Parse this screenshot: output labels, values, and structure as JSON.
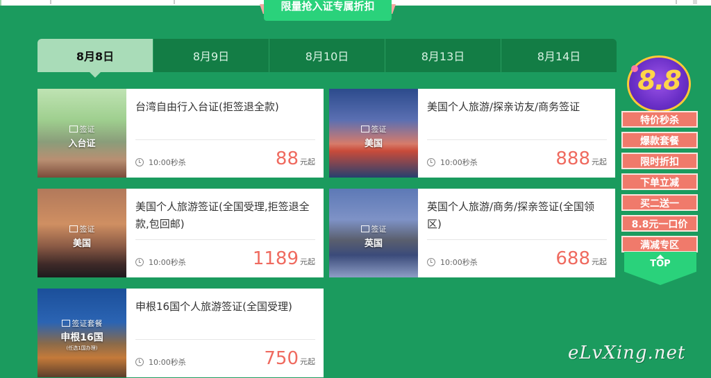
{
  "header": {
    "ribbon_text": "限量抢入证专属折扣"
  },
  "tabs": [
    {
      "label": "8月8日",
      "active": true
    },
    {
      "label": "8月9日",
      "active": false
    },
    {
      "label": "8月10日",
      "active": false
    },
    {
      "label": "8月13日",
      "active": false
    },
    {
      "label": "8月14日",
      "active": false
    }
  ],
  "products": [
    {
      "title": "台湾自由行入台证(拒签退全款)",
      "img_visa": "签证",
      "img_dest": "入台证",
      "img_sub": "",
      "time": "10:00秒杀",
      "price": "88",
      "unit": "元起"
    },
    {
      "title": "美国个人旅游/探亲访友/商务签证",
      "img_visa": "签证",
      "img_dest": "美国",
      "img_sub": "",
      "time": "10:00秒杀",
      "price": "888",
      "unit": "元起"
    },
    {
      "title": "美国个人旅游签证(全国受理,拒签退全款,包回邮)",
      "img_visa": "签证",
      "img_dest": "美国",
      "img_sub": "",
      "time": "10:00秒杀",
      "price": "1189",
      "unit": "元起"
    },
    {
      "title": "英国个人旅游/商务/探亲签证(全国领区)",
      "img_visa": "签证",
      "img_dest": "英国",
      "img_sub": "",
      "time": "10:00秒杀",
      "price": "688",
      "unit": "元起"
    },
    {
      "title": "申根16国个人旅游签证(全国受理)",
      "img_visa": "签证套餐",
      "img_dest": "申根16国",
      "img_sub": "(任选1国办理)",
      "time": "10:00秒杀",
      "price": "750",
      "unit": "元起"
    }
  ],
  "sidebar": {
    "badge": "8.8",
    "items": [
      "特价秒杀",
      "爆款套餐",
      "限时折扣",
      "下单立减",
      "买二送一",
      "8.8元一口价",
      "满减专区"
    ],
    "top": "TOP"
  },
  "watermark": "eLvXing.net",
  "colors": {
    "bg": "#1b9b5e",
    "tab_bar": "#137d45",
    "tab_active": "#a9dcb8",
    "price": "#ef6a5f",
    "menu": "#f07a6b"
  }
}
